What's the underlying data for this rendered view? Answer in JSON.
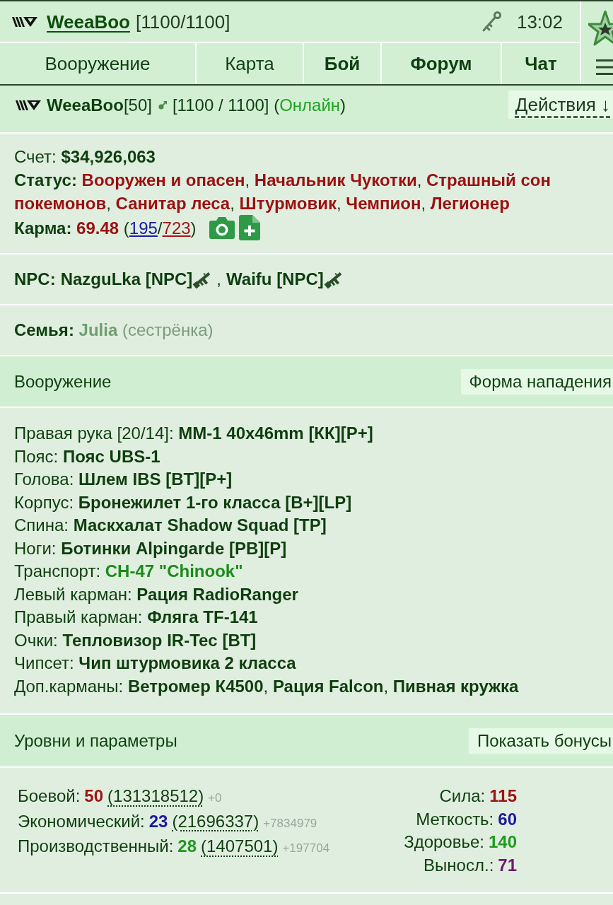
{
  "top_bar": {
    "username": "WeeaBoo",
    "health": "[1100/1100]",
    "time": "13:02"
  },
  "nav": [
    {
      "label": "Вооружение",
      "highlighted": false
    },
    {
      "label": "Карта",
      "highlighted": false
    },
    {
      "label": "Бой",
      "highlighted": true
    },
    {
      "label": "Форум",
      "highlighted": true
    },
    {
      "label": "Чат",
      "highlighted": true
    }
  ],
  "profile": {
    "name": "**WeeaBoo**[50]",
    "status": [
      {
        "text": "[1100 / 1100] (",
        "kind": "plain"
      },
      {
        "text": "Онлайн",
        "kind": "online"
      },
      {
        "text": ")",
        "kind": "plain"
      }
    ],
    "actions_button": "Действия ↓"
  },
  "info": {
    "account": [
      {
        "text": "Счет: ",
        "kind": "plain"
      },
      {
        "text": "$34,926,063",
        "kind": "strong"
      }
    ],
    "status": [
      {
        "text": "Статус: ",
        "kind": "strong"
      },
      {
        "text": "Вооружен и опасен",
        "kind": "title"
      },
      {
        "text": ", ",
        "kind": "plain"
      },
      {
        "text": "Начальник Чукотки",
        "kind": "title"
      },
      {
        "text": ", ",
        "kind": "plain"
      },
      {
        "text": "Страшный сон покемонов",
        "kind": "title"
      },
      {
        "text": ", ",
        "kind": "plain"
      },
      {
        "text": "Санитар леса",
        "kind": "title"
      },
      {
        "text": ", ",
        "kind": "plain"
      },
      {
        "text": "Штурмовик",
        "kind": "title"
      },
      {
        "text": ", ",
        "kind": "plain"
      },
      {
        "text": "Чемпион",
        "kind": "title"
      },
      {
        "text": ", ",
        "kind": "plain"
      },
      {
        "text": "Легионер",
        "kind": "title"
      }
    ],
    "karma": [
      {
        "text": "Карма: ",
        "kind": "strong"
      },
      {
        "text": "69.48",
        "kind": "title"
      },
      {
        "text": " (",
        "kind": "plain"
      },
      {
        "text": "195",
        "kind": "link-blue"
      },
      {
        "text": "/",
        "kind": "plain"
      },
      {
        "text": "723",
        "kind": "link-red"
      },
      {
        "text": ")",
        "kind": "plain"
      }
    ]
  },
  "npc": {
    "label": "NPC:",
    "items": [
      {
        "name": "NazguLka [NPC]",
        "after": ","
      },
      {
        "name": "Waifu [NPC]"
      }
    ]
  },
  "family": [
    {
      "text": "Семья: ",
      "kind": "strong"
    },
    {
      "text": "Julia",
      "kind": "relative"
    },
    {
      "text": " (сестрёнка)",
      "kind": "muted"
    }
  ],
  "equipment": {
    "title": "Вооружение",
    "button": "Форма нападения",
    "rows": [
      [
        {
          "text": "Правая рука [20/14]: ",
          "kind": "plain"
        },
        {
          "text": "ММ-1 40x46mm [КК][P+]",
          "kind": "strong"
        }
      ],
      [
        {
          "text": "Пояс: ",
          "kind": "plain"
        },
        {
          "text": "Пояс UBS-1",
          "kind": "strong"
        }
      ],
      [
        {
          "text": "Голова: ",
          "kind": "plain"
        },
        {
          "text": "Шлем IBS [BT][P+]",
          "kind": "strong"
        }
      ],
      [
        {
          "text": "Корпус: ",
          "kind": "plain"
        },
        {
          "text": "Бронежилет 1-го класса [B+][LP]",
          "kind": "strong"
        }
      ],
      [
        {
          "text": "Спина: ",
          "kind": "plain"
        },
        {
          "text": "Маскхалат Shadow Squad [TP]",
          "kind": "strong"
        }
      ],
      [
        {
          "text": "Ноги: ",
          "kind": "plain"
        },
        {
          "text": "Ботинки Alpingarde [PB][P]",
          "kind": "strong"
        }
      ],
      [
        {
          "text": "Транспорт: ",
          "kind": "plain"
        },
        {
          "text": "CH-47 \"Chinook\"",
          "kind": "vehicle"
        }
      ],
      [
        {
          "text": "Левый карман: ",
          "kind": "plain"
        },
        {
          "text": "Рация RadioRanger",
          "kind": "strong"
        }
      ],
      [
        {
          "text": "Правый карман: ",
          "kind": "plain"
        },
        {
          "text": "Фляга TF-141",
          "kind": "strong"
        }
      ],
      [
        {
          "text": "Очки: ",
          "kind": "plain"
        },
        {
          "text": "Тепловизор IR-Tec [BT]",
          "kind": "strong"
        }
      ],
      [
        {
          "text": "Чипсет: ",
          "kind": "plain"
        },
        {
          "text": "Чип штурмовика 2 класса",
          "kind": "strong"
        }
      ],
      [
        {
          "text": "Доп.карманы: ",
          "kind": "plain"
        },
        {
          "text": "Ветромер К4500",
          "kind": "strong"
        },
        {
          "text": ", ",
          "kind": "plain"
        },
        {
          "text": "Рация Falcon",
          "kind": "strong"
        },
        {
          "text": ", ",
          "kind": "plain"
        },
        {
          "text": "Пивная кружка",
          "kind": "strong"
        }
      ]
    ]
  },
  "levels": {
    "title": "Уровни и параметры",
    "button": "Показать бонусы",
    "skills": [
      {
        "name": "Боевой:",
        "level": "50",
        "experience": "(131318512)",
        "bonus": "+0",
        "color": "#a01414"
      },
      {
        "name": "Экономический:",
        "level": "23",
        "experience": "(21696337)",
        "bonus": "+7834979",
        "color": "#1c1c9a"
      },
      {
        "name": "Производственный:",
        "level": "28",
        "experience": "(1407501)",
        "bonus": "+197704",
        "color": "#1f9a1f"
      }
    ],
    "attributes": [
      {
        "name": "Сила:",
        "value": "115",
        "color": "#a01414"
      },
      {
        "name": "Меткость:",
        "value": "60",
        "color": "#1c1c9a"
      },
      {
        "name": "Здоровье:",
        "value": "140",
        "color": "#1f9a1f"
      },
      {
        "name": "Выносл.:",
        "value": "71",
        "color": "#6e1a6e"
      }
    ]
  }
}
